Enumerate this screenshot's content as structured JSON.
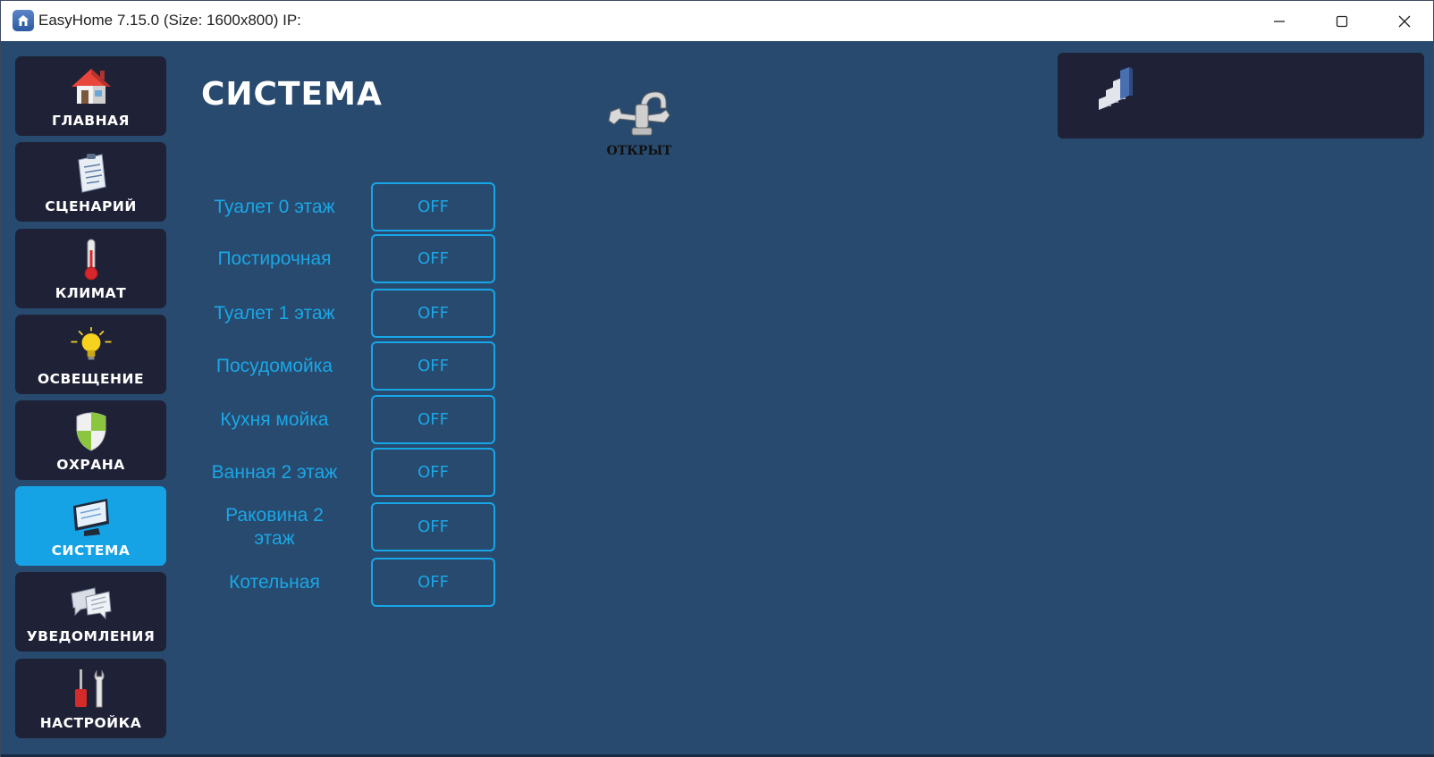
{
  "window": {
    "title": "EasyHome 7.15.0 (Size: 1600x800) IP:"
  },
  "sidebar": {
    "items": [
      {
        "label": "ГЛАВНАЯ",
        "icon": "house-icon",
        "active": false
      },
      {
        "label": "СЦЕНАРИЙ",
        "icon": "clipboard-icon",
        "active": false
      },
      {
        "label": "КЛИМАТ",
        "icon": "thermometer-icon",
        "active": false
      },
      {
        "label": "ОСВЕЩЕНИЕ",
        "icon": "light-bulb-icon",
        "active": false
      },
      {
        "label": "ОХРАНА",
        "icon": "shield-icon",
        "active": false
      },
      {
        "label": "СИСТЕМА",
        "icon": "monitor-icon",
        "active": true
      },
      {
        "label": "УВЕДОМЛЕНИЯ",
        "icon": "chat-bubbles-icon",
        "active": false
      },
      {
        "label": "НАСТРОЙКА",
        "icon": "tools-icon",
        "active": false
      }
    ]
  },
  "main": {
    "title": "СИСТЕМА",
    "faucet": {
      "label": "ОТКРЫТ",
      "icon": "faucet-icon"
    },
    "status_panel": {
      "icon": "signal-bars-icon"
    },
    "rows": [
      {
        "label": "Туалет 0 этаж",
        "state": "OFF"
      },
      {
        "label": "Постирочная",
        "state": "OFF"
      },
      {
        "label": "Туалет 1 этаж",
        "state": "OFF"
      },
      {
        "label": "Посудомойка",
        "state": "OFF"
      },
      {
        "label": "Кухня мойка",
        "state": "OFF"
      },
      {
        "label": "Ванная 2 этаж",
        "state": "OFF"
      },
      {
        "label": "Раковина 2 этаж",
        "state": "OFF"
      },
      {
        "label": "Котельная",
        "state": "OFF"
      }
    ]
  },
  "colors": {
    "background": "#284a6e",
    "sidebar_item": "#1f2236",
    "active_item": "#16a3e6",
    "accent": "#1aa7e6"
  }
}
